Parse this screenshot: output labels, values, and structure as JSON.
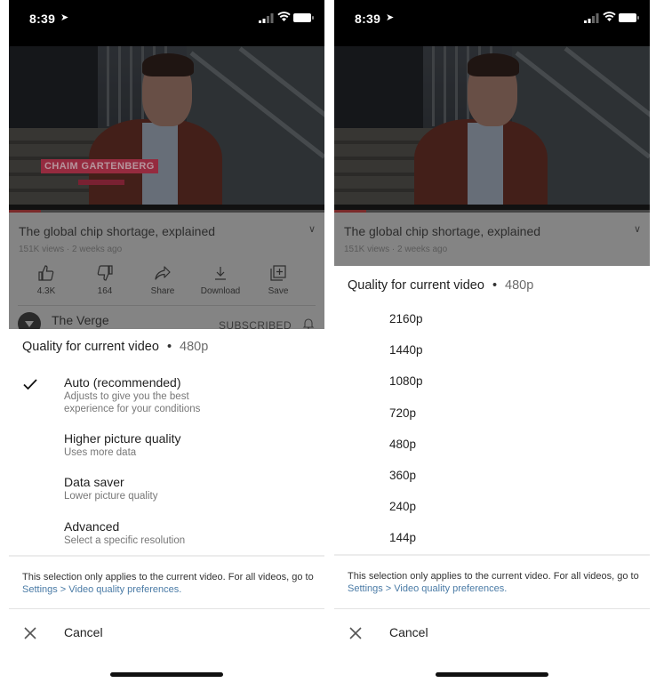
{
  "status_bar": {
    "time": "8:39",
    "location_icon": "location-arrow-icon",
    "signal_icon": "cellular-signal-icon",
    "wifi_icon": "wifi-icon",
    "battery_icon": "battery-icon"
  },
  "video": {
    "lower_third_name": "CHAIM GARTENBERG",
    "progress_fraction": 0.1,
    "progress_color": "#7a2a2a"
  },
  "meta": {
    "title": "The global chip shortage, explained",
    "subtitle": "151K views · 2 weeks ago",
    "expand_icon": "chevron-down-icon",
    "actions": [
      {
        "icon": "thumbs-up-icon",
        "label": "4.3K"
      },
      {
        "icon": "thumbs-down-icon",
        "label": "164"
      },
      {
        "icon": "share-icon",
        "label": "Share"
      },
      {
        "icon": "download-icon",
        "label": "Download"
      },
      {
        "icon": "save-playlist-icon",
        "label": "Save"
      }
    ],
    "channel": {
      "name": "The Verge",
      "subscribe_label": "SUBSCRIBED",
      "bell_icon": "notification-bell-icon"
    }
  },
  "left_sheet": {
    "header_label": "Quality for current video",
    "header_separator": "•",
    "current_resolution": "480p",
    "options": [
      {
        "name": "Auto (recommended)",
        "desc_line1": "Adjusts to give you the best",
        "desc_line2": "experience for your conditions",
        "selected": true
      },
      {
        "name": "Higher picture quality",
        "desc_line1": "Uses more data",
        "desc_line2": "",
        "selected": false
      },
      {
        "name": "Data saver",
        "desc_line1": "Lower picture quality",
        "desc_line2": "",
        "selected": false
      },
      {
        "name": "Advanced",
        "desc_line1": "Select a specific resolution",
        "desc_line2": "",
        "selected": false
      }
    ]
  },
  "right_sheet": {
    "header_label": "Quality for current video",
    "header_separator": "•",
    "current_resolution": "480p",
    "resolutions": [
      "2160p",
      "1440p",
      "1080p",
      "720p",
      "480p",
      "360p",
      "240p",
      "144p"
    ]
  },
  "footer": {
    "note_text": "This selection only applies to the current video. For all videos, go to ",
    "note_link": "Settings > Video quality preferences.",
    "cancel_label": "Cancel",
    "link_color": "#4a7ba6"
  }
}
